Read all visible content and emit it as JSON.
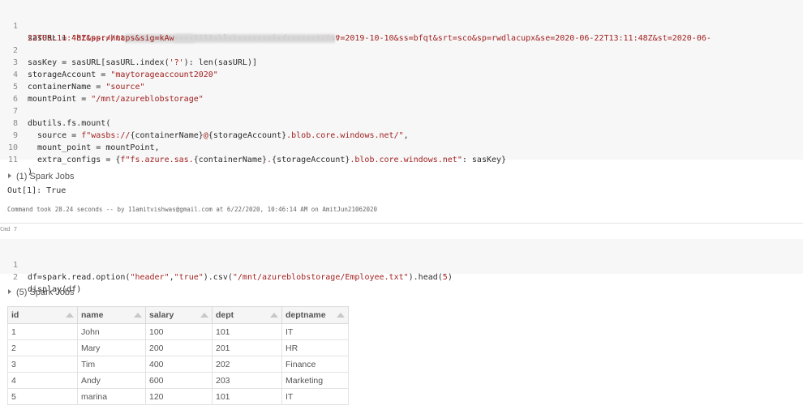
{
  "cell1": {
    "lines": [
      {
        "n": "1",
        "parts": [
          [
            "sasURL = ",
            ""
          ],
          [
            "\"https://ma",
            ""
          ],
          [
            "ytorageaccount",
            ""
          ],
          [
            "2020.blob.core.windows.net/?sv=2019-10-10&ss=bfqt&srt=sco&sp=rwdlacupx&se=2020-06-22T13:11:48Z&st=2020-06-",
            ""
          ]
        ]
      },
      {
        "n": "",
        "parts": [
          [
            "22T05:11:48Z&spr=https&sig=kAw",
            ""
          ],
          [
            "XXXXXXXXXXXXXXXXXXXXXXXXXXXXXXX",
            ""
          ],
          [
            "\"",
            ""
          ]
        ]
      },
      {
        "n": "2",
        "parts": [
          [
            "sasKey = sasURL[sasURL.index('?'): len(sasURL)]",
            ""
          ]
        ]
      },
      {
        "n": "3",
        "parts": [
          [
            "storageAccount = ",
            ""
          ],
          [
            "\"maytorageaccount2020\"",
            ""
          ]
        ]
      },
      {
        "n": "4",
        "parts": [
          [
            "containerName = ",
            ""
          ],
          [
            "\"source\"",
            ""
          ]
        ]
      },
      {
        "n": "5",
        "parts": [
          [
            "mountPoint = ",
            ""
          ],
          [
            "\"/mnt/azureblobstorage\"",
            ""
          ]
        ]
      },
      {
        "n": "6",
        "parts": [
          [
            "",
            ""
          ]
        ]
      },
      {
        "n": "7",
        "parts": [
          [
            "dbutils.fs.mount(",
            ""
          ]
        ]
      },
      {
        "n": "8",
        "parts": [
          [
            "  source = ",
            ""
          ],
          [
            "f\"wasbs://",
            ""
          ],
          [
            "{containerName}",
            ""
          ],
          [
            "@",
            ""
          ],
          [
            "{storageAccount}",
            ""
          ],
          [
            ".blob.core.windows.net/\"",
            ""
          ],
          [
            ",",
            ""
          ]
        ]
      },
      {
        "n": "9",
        "parts": [
          [
            "  mount_point = mountPoint,",
            ""
          ]
        ]
      },
      {
        "n": "10",
        "parts": [
          [
            "  extra_configs = {",
            ""
          ],
          [
            "f\"fs.azure.sas.",
            ""
          ],
          [
            "{containerName}",
            ""
          ],
          [
            ".",
            ""
          ],
          [
            "{storageAccount}",
            ""
          ],
          [
            ".blob.core.windows.net\"",
            ""
          ],
          [
            ": sasKey}",
            ""
          ]
        ]
      },
      {
        "n": "11",
        "parts": [
          [
            ")",
            ""
          ]
        ]
      }
    ]
  },
  "spark1": "(1) Spark Jobs",
  "out1": "Out[1]: True",
  "took": "Command took 28.24 seconds -- by 11amitvishwas@gmail.com at 6/22/2020, 10:46:14 AM on AmitJun21062020",
  "cmd": "Cmd 7",
  "cell2": {
    "line1_num": "1",
    "line1_a": "df=spark.read.option(",
    "line1_b": "\"header\"",
    "line1_c": ",",
    "line1_d": "\"true\"",
    "line1_e": ").csv(",
    "line1_f": "\"/mnt/azureblobstorage/Employee.txt\"",
    "line1_g": ").head(",
    "line1_h": "5",
    "line1_i": ")",
    "line2_num": "2",
    "line2": "display(df)"
  },
  "spark2": "(5) Spark Jobs",
  "table": {
    "headers": [
      "id",
      "name",
      "salary",
      "dept",
      "deptname"
    ],
    "rows": [
      [
        "1",
        "John",
        "100",
        "101",
        "IT"
      ],
      [
        "2",
        "Mary",
        "200",
        "201",
        "HR"
      ],
      [
        "3",
        "Tim",
        "400",
        "202",
        "Finance"
      ],
      [
        "4",
        "Andy",
        "600",
        "203",
        "Marketing"
      ],
      [
        "5",
        "marina",
        "120",
        "101",
        "IT"
      ]
    ]
  },
  "colors": {
    "string": "#a11f1f",
    "cell_bg": "#f7f7f7",
    "line_number": "#8a8a8a"
  }
}
